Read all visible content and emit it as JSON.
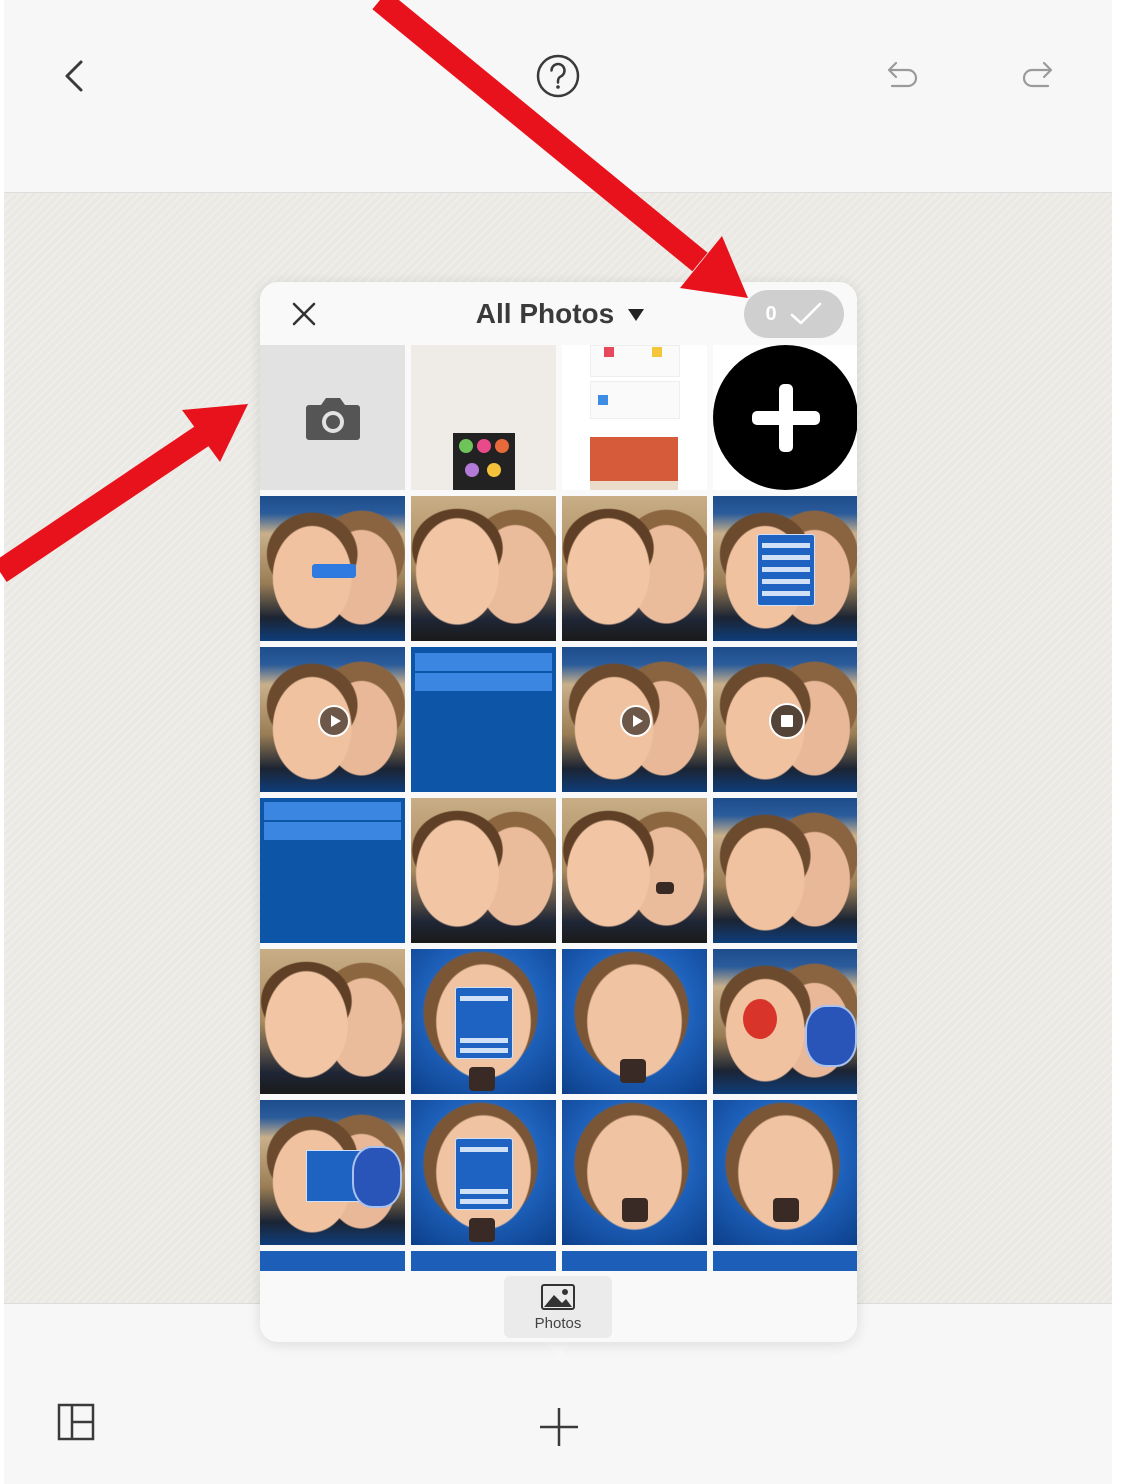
{
  "toolbar": {
    "back_icon": "chevron-left-icon",
    "help_icon": "question-circle-icon",
    "undo_icon": "undo-icon",
    "redo_icon": "redo-icon"
  },
  "picker": {
    "title": "All Photos",
    "dropdown_icon": "caret-down-icon",
    "close_icon": "close-icon",
    "selected_count": "0",
    "confirm_icon": "checkmark-icon",
    "footer_tab_label": "Photos",
    "footer_tab_icon": "image-icon"
  },
  "bottom_toolbar": {
    "layout_icon": "layout-grid-icon",
    "add_icon": "plus-icon"
  },
  "colors": {
    "annotation_arrow": "#e8121c",
    "selection_pill": "#cfcfcf"
  }
}
